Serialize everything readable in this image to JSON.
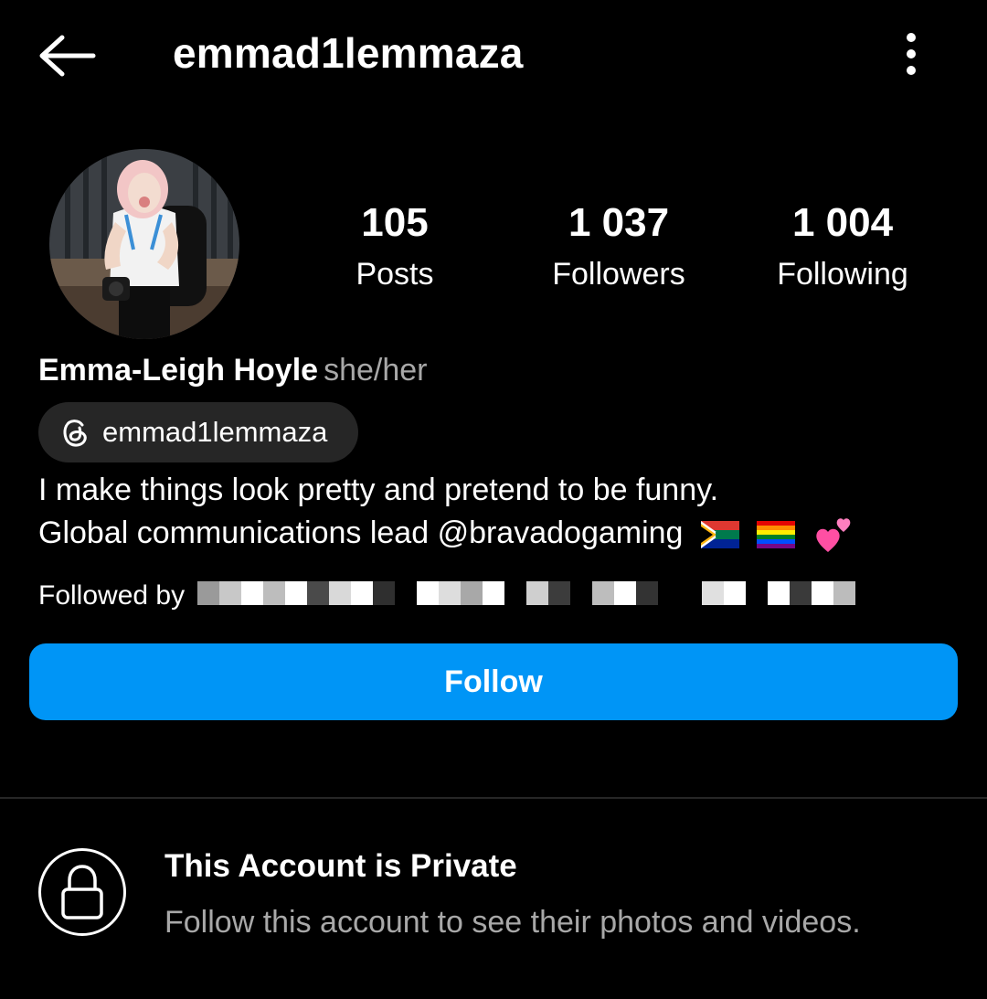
{
  "header": {
    "title": "emmad1lemmaza",
    "back_icon": "arrow-left-icon",
    "more_icon": "more-vertical-icon"
  },
  "profile": {
    "stats": [
      {
        "value": "105",
        "label": "Posts"
      },
      {
        "value": "1 037",
        "label": "Followers"
      },
      {
        "value": "1 004",
        "label": "Following"
      }
    ],
    "name": "Emma-Leigh Hoyle",
    "pronouns": "she/her",
    "threads_handle": "emmad1lemmaza",
    "bio_line1": "I make things look pretty and pretend to be funny.",
    "bio_line2_prefix": "Global communications lead ",
    "bio_mention": "@bravadogaming",
    "bio_emojis": [
      "south-africa-flag",
      "rainbow-flag",
      "two-hearts"
    ],
    "followed_by_label": "Followed by"
  },
  "actions": {
    "follow_label": "Follow"
  },
  "private": {
    "title": "This Account is Private",
    "subtitle": "Follow this account to see their photos and videos."
  },
  "colors": {
    "background": "#000000",
    "follow_button": "#0095f6",
    "pill_bg": "#262626",
    "secondary_text": "#a8a8a8"
  }
}
